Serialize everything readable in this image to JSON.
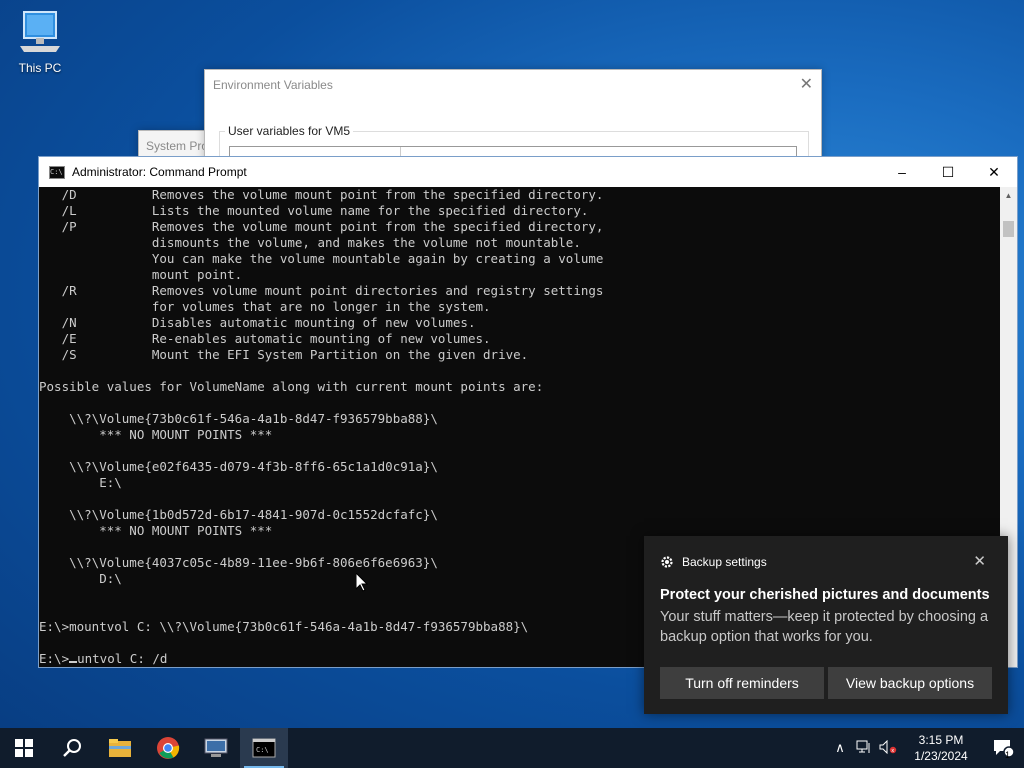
{
  "desktop": {
    "icons": [
      {
        "label": "This PC",
        "icon": "computer-icon"
      }
    ]
  },
  "env_window": {
    "title": "Environment Variables",
    "group_label": "User variables for VM5"
  },
  "sysprops_window": {
    "title": "System Prop"
  },
  "cmd_window": {
    "title": "Administrator: Command Prompt",
    "lines": [
      "   /D          Removes the volume mount point from the specified directory.",
      "   /L          Lists the mounted volume name for the specified directory.",
      "   /P          Removes the volume mount point from the specified directory,",
      "               dismounts the volume, and makes the volume not mountable.",
      "               You can make the volume mountable again by creating a volume",
      "               mount point.",
      "   /R          Removes volume mount point directories and registry settings",
      "               for volumes that are no longer in the system.",
      "   /N          Disables automatic mounting of new volumes.",
      "   /E          Re-enables automatic mounting of new volumes.",
      "   /S          Mount the EFI System Partition on the given drive.",
      "",
      "Possible values for VolumeName along with current mount points are:",
      "",
      "    \\\\?\\Volume{73b0c61f-546a-4a1b-8d47-f936579bba88}\\",
      "        *** NO MOUNT POINTS ***",
      "",
      "    \\\\?\\Volume{e02f6435-d079-4f3b-8ff6-65c1a1d0c91a}\\",
      "        E:\\",
      "",
      "    \\\\?\\Volume{1b0d572d-6b17-4841-907d-0c1552dcfafc}\\",
      "        *** NO MOUNT POINTS ***",
      "",
      "    \\\\?\\Volume{4037c05c-4b89-11ee-9b6f-806e6f6e6963}\\",
      "        D:\\",
      "",
      "",
      "E:\\>mountvol C: \\\\?\\Volume{73b0c61f-546a-4a1b-8d47-f936579bba88}\\",
      ""
    ],
    "prompt": "E:\\>",
    "current_input": "untvol C: /d"
  },
  "toast": {
    "app_name": "Backup settings",
    "title": "Protect your cherished pictures and documents",
    "body": "Your stuff matters—keep it protected by choosing a backup option that works for you.",
    "button_1": "Turn off reminders",
    "button_2": "View backup options"
  },
  "taskbar": {
    "apps": [
      "start-icon",
      "search-icon",
      "file-explorer-icon",
      "chrome-icon",
      "remote-desktop-icon",
      "command-prompt-icon"
    ],
    "time": "3:15 PM",
    "date": "1/23/2024",
    "notification_count": "1"
  }
}
